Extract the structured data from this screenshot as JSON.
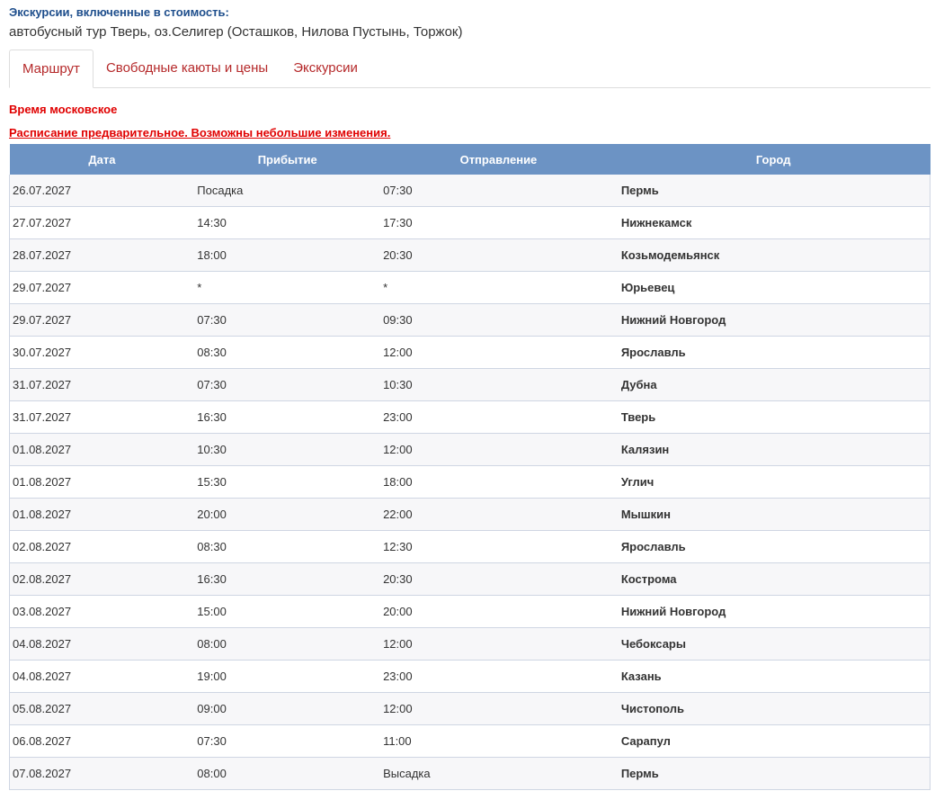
{
  "excursions": {
    "title": "Экскурсии, включенные в стоимость:",
    "text": "автобусный тур Тверь, оз.Селигер (Осташков, Нилова Пустынь, Торжок)"
  },
  "tabs": [
    {
      "label": "Маршрут",
      "active": true
    },
    {
      "label": "Свободные каюты и цены",
      "active": false
    },
    {
      "label": "Экскурсии",
      "active": false
    }
  ],
  "notes": {
    "time": "Время московское",
    "schedule": "Расписание предварительное. Возможны небольшие изменения."
  },
  "table": {
    "headers": [
      "Дата",
      "Прибытие",
      "Отправление",
      "Город"
    ],
    "rows": [
      {
        "date": "26.07.2027",
        "arrival": "Посадка",
        "departure": "07:30",
        "city": "Пермь"
      },
      {
        "date": "27.07.2027",
        "arrival": "14:30",
        "departure": "17:30",
        "city": "Нижнекамск"
      },
      {
        "date": "28.07.2027",
        "arrival": "18:00",
        "departure": "20:30",
        "city": "Козьмодемьянск"
      },
      {
        "date": "29.07.2027",
        "arrival": "*",
        "departure": "*",
        "city": "Юрьевец"
      },
      {
        "date": "29.07.2027",
        "arrival": "07:30",
        "departure": "09:30",
        "city": "Нижний Новгород"
      },
      {
        "date": "30.07.2027",
        "arrival": "08:30",
        "departure": "12:00",
        "city": "Ярославль"
      },
      {
        "date": "31.07.2027",
        "arrival": "07:30",
        "departure": "10:30",
        "city": "Дубна"
      },
      {
        "date": "31.07.2027",
        "arrival": "16:30",
        "departure": "23:00",
        "city": "Тверь"
      },
      {
        "date": "01.08.2027",
        "arrival": "10:30",
        "departure": "12:00",
        "city": "Калязин"
      },
      {
        "date": "01.08.2027",
        "arrival": "15:30",
        "departure": "18:00",
        "city": "Углич"
      },
      {
        "date": "01.08.2027",
        "arrival": "20:00",
        "departure": "22:00",
        "city": "Мышкин"
      },
      {
        "date": "02.08.2027",
        "arrival": "08:30",
        "departure": "12:30",
        "city": "Ярославль"
      },
      {
        "date": "02.08.2027",
        "arrival": "16:30",
        "departure": "20:30",
        "city": "Кострома"
      },
      {
        "date": "03.08.2027",
        "arrival": "15:00",
        "departure": "20:00",
        "city": "Нижний Новгород"
      },
      {
        "date": "04.08.2027",
        "arrival": "08:00",
        "departure": "12:00",
        "city": "Чебоксары"
      },
      {
        "date": "04.08.2027",
        "arrival": "19:00",
        "departure": "23:00",
        "city": "Казань"
      },
      {
        "date": "05.08.2027",
        "arrival": "09:00",
        "departure": "12:00",
        "city": "Чистополь"
      },
      {
        "date": "06.08.2027",
        "arrival": "07:30",
        "departure": "11:00",
        "city": "Сарапул"
      },
      {
        "date": "07.08.2027",
        "arrival": "08:00",
        "departure": "Высадка",
        "city": "Пермь"
      }
    ]
  }
}
